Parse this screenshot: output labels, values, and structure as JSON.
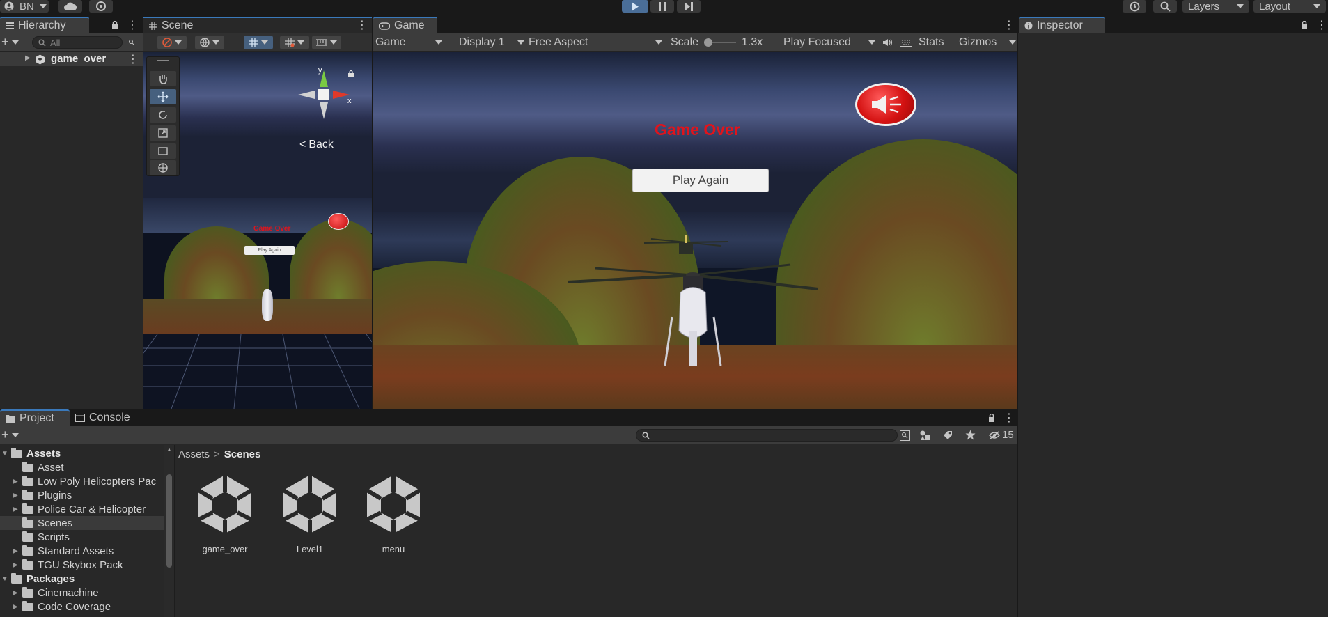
{
  "toolbar": {
    "account": "BN",
    "layers": "Layers",
    "layout": "Layout"
  },
  "hierarchy": {
    "tab": "Hierarchy",
    "search_placeholder": "All",
    "root": "game_over"
  },
  "scene": {
    "tab": "Scene",
    "back_label": "Back",
    "gizmo_y": "y",
    "gizmo_x": "x"
  },
  "game": {
    "tab": "Game",
    "view_mode": "Game",
    "display": "Display 1",
    "aspect": "Free Aspect",
    "scale_label": "Scale",
    "scale_value": "1.3x",
    "play_mode": "Play Focused",
    "stats": "Stats",
    "gizmos": "Gizmos",
    "title": "Game Over",
    "play_again": "Play Again",
    "mini_title": "Game Over",
    "mini_play_again": "Play Again"
  },
  "inspector": {
    "tab": "Inspector"
  },
  "project": {
    "tab": "Project",
    "console_tab": "Console",
    "hidden_count": "15",
    "breadcrumb_root": "Assets",
    "breadcrumb_current": "Scenes",
    "tree": [
      {
        "label": "Assets",
        "bold": true
      },
      {
        "label": "Asset"
      },
      {
        "label": "Low Poly Helicopters Pac"
      },
      {
        "label": "Plugins"
      },
      {
        "label": "Police Car & Helicopter"
      },
      {
        "label": "Scenes"
      },
      {
        "label": "Scripts"
      },
      {
        "label": "Standard Assets"
      },
      {
        "label": "TGU Skybox Pack"
      },
      {
        "label": "Packages",
        "bold": true
      },
      {
        "label": "Cinemachine"
      },
      {
        "label": "Code Coverage"
      }
    ],
    "assets": [
      "game_over",
      "Level1",
      "menu"
    ]
  },
  "colors": {
    "accent": "#3a79bb",
    "title_red": "#e0141c",
    "panel": "#282828"
  }
}
